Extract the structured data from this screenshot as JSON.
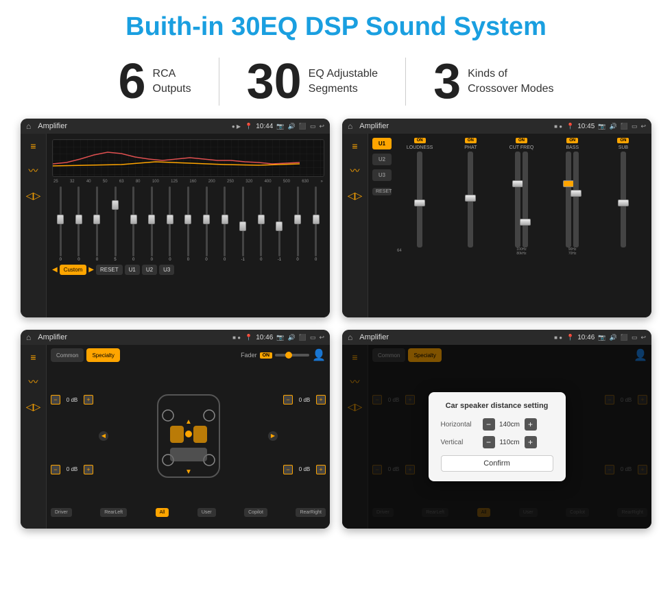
{
  "page": {
    "title": "Buith-in 30EQ DSP Sound System"
  },
  "features": [
    {
      "num": "6",
      "label_line1": "RCA",
      "label_line2": "Outputs"
    },
    {
      "num": "30",
      "label_line1": "EQ Adjustable",
      "label_line2": "Segments"
    },
    {
      "num": "3",
      "label_line1": "Kinds of",
      "label_line2": "Crossover Modes"
    }
  ],
  "screen1": {
    "app_title": "Amplifier",
    "time": "10:44",
    "freq_bands": [
      "25",
      "32",
      "40",
      "50",
      "63",
      "80",
      "100",
      "125",
      "160",
      "200",
      "250",
      "320",
      "400",
      "500",
      "630"
    ],
    "slider_vals": [
      "0",
      "0",
      "0",
      "5",
      "0",
      "0",
      "0",
      "0",
      "0",
      "0",
      "-1",
      "0",
      "-1",
      "",
      ""
    ],
    "eq_preset": "Custom",
    "buttons": [
      "RESET",
      "U1",
      "U2",
      "U3"
    ]
  },
  "screen2": {
    "app_title": "Amplifier",
    "time": "10:45",
    "u_buttons": [
      "U1",
      "U2",
      "U3"
    ],
    "channels": [
      {
        "label": "LOUDNESS",
        "on": true
      },
      {
        "label": "PHAT",
        "on": true
      },
      {
        "label": "CUT FREQ",
        "on": true
      },
      {
        "label": "BASS",
        "on": true
      },
      {
        "label": "SUB",
        "on": true
      }
    ],
    "reset_label": "RESET"
  },
  "screen3": {
    "app_title": "Amplifier",
    "time": "10:46",
    "tabs": [
      "Common",
      "Specialty"
    ],
    "active_tab": "Specialty",
    "fader_label": "Fader",
    "fader_on": true,
    "vol_controls": [
      {
        "label": "0 dB",
        "position": "front-left"
      },
      {
        "label": "0 dB",
        "position": "front-right"
      },
      {
        "label": "0 dB",
        "position": "rear-left"
      },
      {
        "label": "0 dB",
        "position": "rear-right"
      }
    ],
    "bottom_buttons": [
      "Driver",
      "RearLeft",
      "All",
      "User",
      "Copilot",
      "RearRight"
    ]
  },
  "screen4": {
    "app_title": "Amplifier",
    "time": "10:46",
    "tabs": [
      "Common",
      "Specialty"
    ],
    "dialog": {
      "title": "Car speaker distance setting",
      "horizontal_label": "Horizontal",
      "horizontal_value": "140cm",
      "vertical_label": "Vertical",
      "vertical_value": "110cm",
      "confirm_label": "Confirm"
    },
    "vol_controls": [
      {
        "label": "0 dB"
      },
      {
        "label": "0 dB"
      }
    ],
    "bottom_buttons": [
      "Driver",
      "RearLeft",
      "All",
      "User",
      "Copilot",
      "RearRight"
    ]
  }
}
